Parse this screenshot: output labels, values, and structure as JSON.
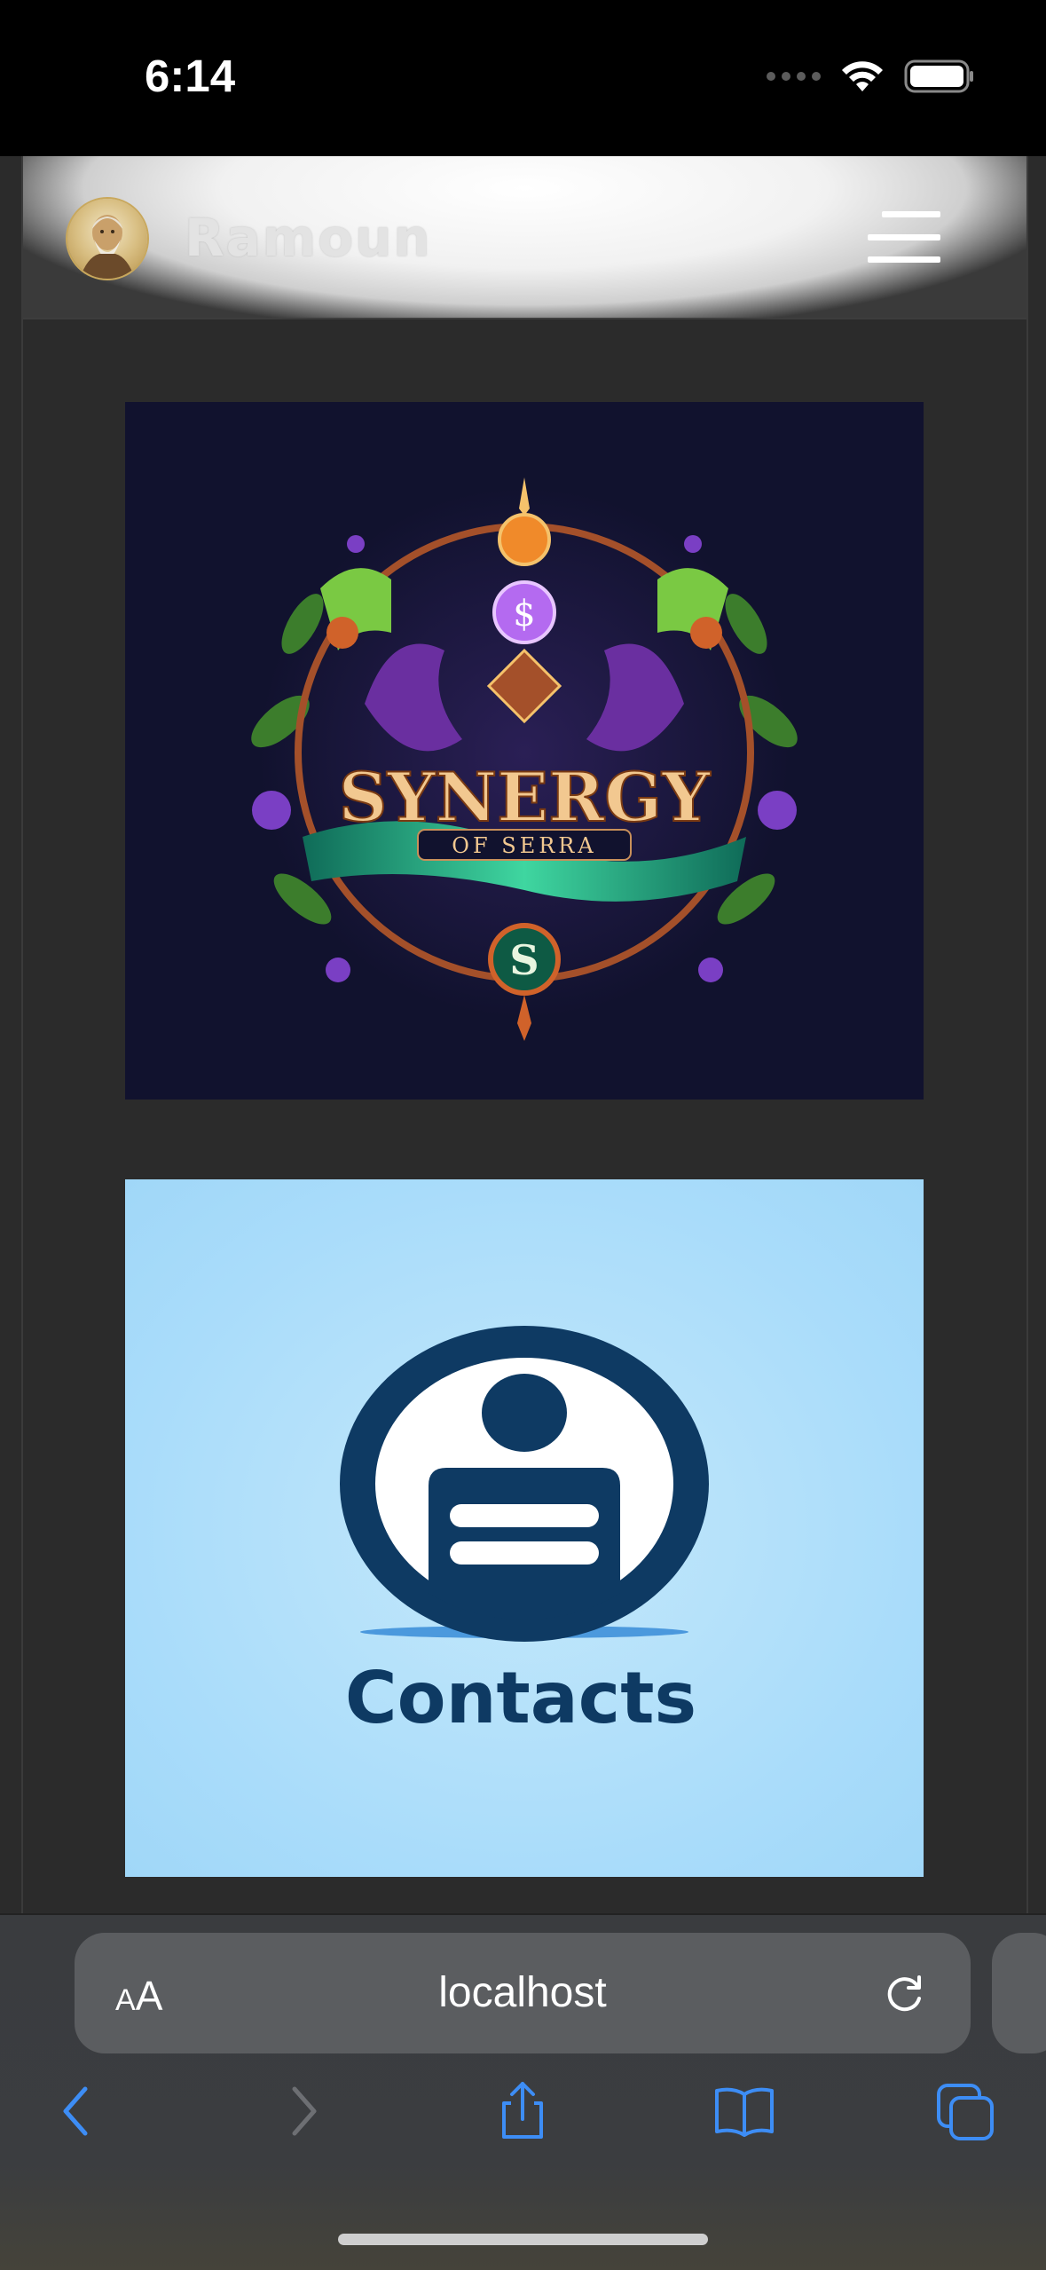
{
  "status_bar": {
    "time": "6:14",
    "icons": [
      "cellular-signal-icon",
      "wifi-icon",
      "battery-icon"
    ]
  },
  "navbar": {
    "brand": "Ramoun",
    "avatar": "avatar-portrait",
    "menu_icon": "hamburger-menu-icon"
  },
  "cards": [
    {
      "title": "SYNERGY",
      "subtitle": "OF SERRA",
      "emblem_letter": "S"
    },
    {
      "label": "Contacts"
    }
  ],
  "browser": {
    "text_size_label_small": "A",
    "text_size_label_large": "A",
    "url": "localhost",
    "toolbar_icons": [
      "back-icon",
      "forward-icon",
      "share-icon",
      "bookmarks-icon",
      "tabs-icon"
    ]
  },
  "colors": {
    "page_bg": "#2b2b2b",
    "accent_blue": "#3d8df5",
    "contacts_navy": "#0e3a63",
    "card1_bg": "#11122e",
    "card2_bg": "#a9dcfa"
  }
}
